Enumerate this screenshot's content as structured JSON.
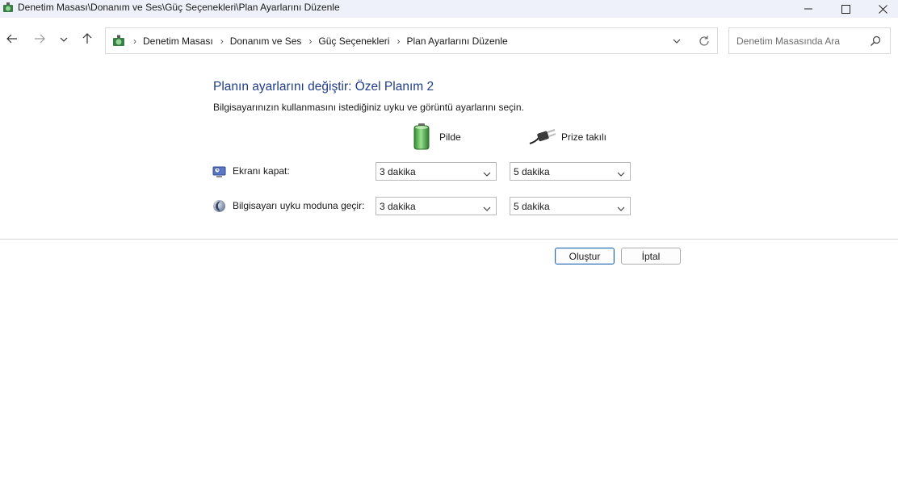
{
  "window": {
    "title": "Denetim Masası\\Donanım ve Ses\\Güç Seçenekleri\\Plan Ayarlarını Düzenle",
    "icon": "control-panel-icon"
  },
  "nav": {
    "breadcrumbs": [
      "Denetim Masası",
      "Donanım ve Ses",
      "Güç Seçenekleri",
      "Plan Ayarlarını Düzenle"
    ],
    "separator": "›"
  },
  "search": {
    "placeholder": "Denetim Masasında Ara"
  },
  "main": {
    "title": "Planın ayarlarını değiştir: Özel Planım 2",
    "subtitle": "Bilgisayarınızın kullanmasını istediğiniz uyku ve görüntü ayarlarını seçin.",
    "columns": {
      "battery": "Pilde",
      "plugged": "Prize takılı"
    },
    "rows": [
      {
        "label": "Ekranı kapat:",
        "battery": "3 dakika",
        "plugged": "5 dakika",
        "icon": "monitor-clock-icon"
      },
      {
        "label": "Bilgisayarı uyku moduna geçir:",
        "battery": "3 dakika",
        "plugged": "5 dakika",
        "icon": "moon-icon"
      }
    ]
  },
  "buttons": {
    "create": "Oluştur",
    "cancel": "İptal"
  },
  "colors": {
    "title_blue": "#1f3c88",
    "titlebar_bg": "#eef1f9",
    "primary_border": "#2b6cb0"
  }
}
